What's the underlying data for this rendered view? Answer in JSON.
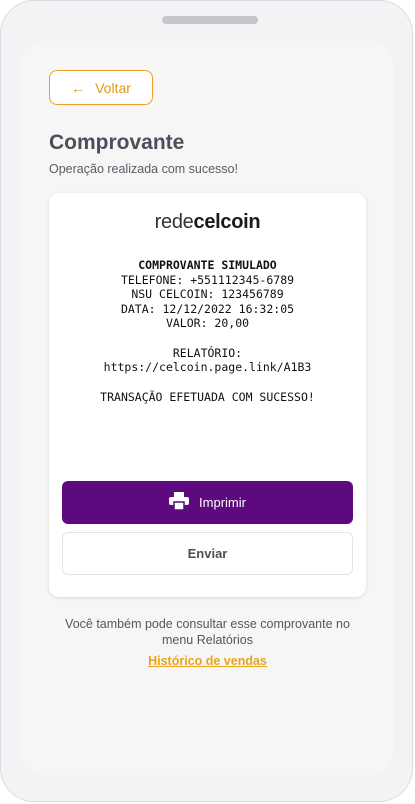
{
  "back_button": {
    "label": "Voltar",
    "icon": "arrow-left-icon"
  },
  "header": {
    "title": "Comprovante",
    "subtitle": "Operação realizada com sucesso!"
  },
  "logo": {
    "light": "rede",
    "bold": "celcoin"
  },
  "receipt": {
    "heading": "COMPROVANTE SIMULADO",
    "telefone": "TELEFONE: +551112345-6789",
    "nsu": "NSU CELCOIN: 123456789",
    "data": "DATA: 12/12/2022 16:32:05",
    "valor": "VALOR: 20,00",
    "relatorio_label": "RELATÓRIO:",
    "relatorio_link": "https://celcoin.page.link/A1B3",
    "status": "TRANSAÇÃO EFETUADA COM SUCESSO!"
  },
  "actions": {
    "print_label": "Imprimir",
    "print_icon": "printer-icon",
    "send_label": "Enviar"
  },
  "footer": {
    "info_text": "Você também pode consultar esse comprovante no menu Relatórios",
    "history_link": "Histórico de vendas"
  },
  "colors": {
    "accent": "#e9a31c",
    "primary": "#5c0a7d",
    "title": "#4e4e5a"
  }
}
